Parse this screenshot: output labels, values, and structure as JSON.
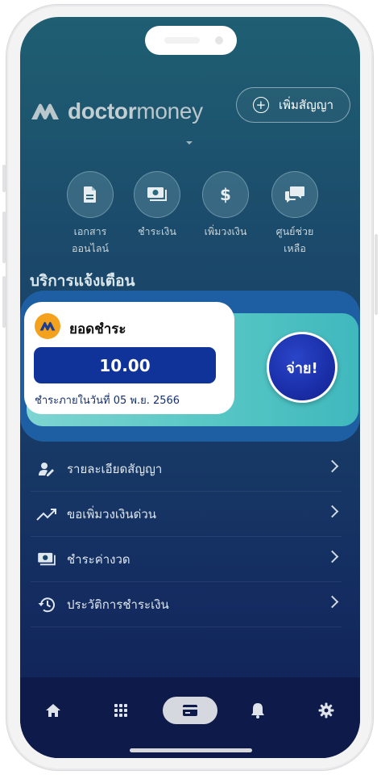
{
  "header": {
    "brand_bold": "doctor",
    "brand_light": "money",
    "add_contract_label": "เพิ่มสัญญา"
  },
  "quick_actions": [
    {
      "label_line1": "เอกสาร",
      "label_line2": "ออนไลน์",
      "icon": "document-icon"
    },
    {
      "label_line1": "ชำระเงิน",
      "icon": "cash-icon"
    },
    {
      "label_line1": "เพิ่มวงเงิน",
      "icon": "dollar-icon"
    },
    {
      "label_line1": "ศูนย์ช่วยเหลือ",
      "icon": "chat-icon"
    }
  ],
  "notification": {
    "section_title": "บริการแจ้งเตือน",
    "card_title": "ยอดชำระ",
    "amount": "10.00",
    "due_text": "ชำระภายในวันที่ 05 พ.ย. 2566",
    "pay_label": "จ่าย!"
  },
  "menu": [
    {
      "label": "รายละเอียดสัญญา",
      "icon": "user-edit-icon"
    },
    {
      "label": "ขอเพิ่มวงเงินด่วน",
      "icon": "trending-up-icon"
    },
    {
      "label": "ชำระค่างวด",
      "icon": "cash-icon"
    },
    {
      "label": "ประวัติการชำระเงิน",
      "icon": "history-icon"
    }
  ],
  "tabbar": {
    "items": [
      "home-icon",
      "apps-grid-icon",
      "card-icon",
      "bell-icon",
      "gear-icon"
    ],
    "active": "card-icon"
  },
  "colors": {
    "accent_navy": "#10339a",
    "teal": "#58c7c5",
    "badge_orange": "#f4a21e"
  }
}
